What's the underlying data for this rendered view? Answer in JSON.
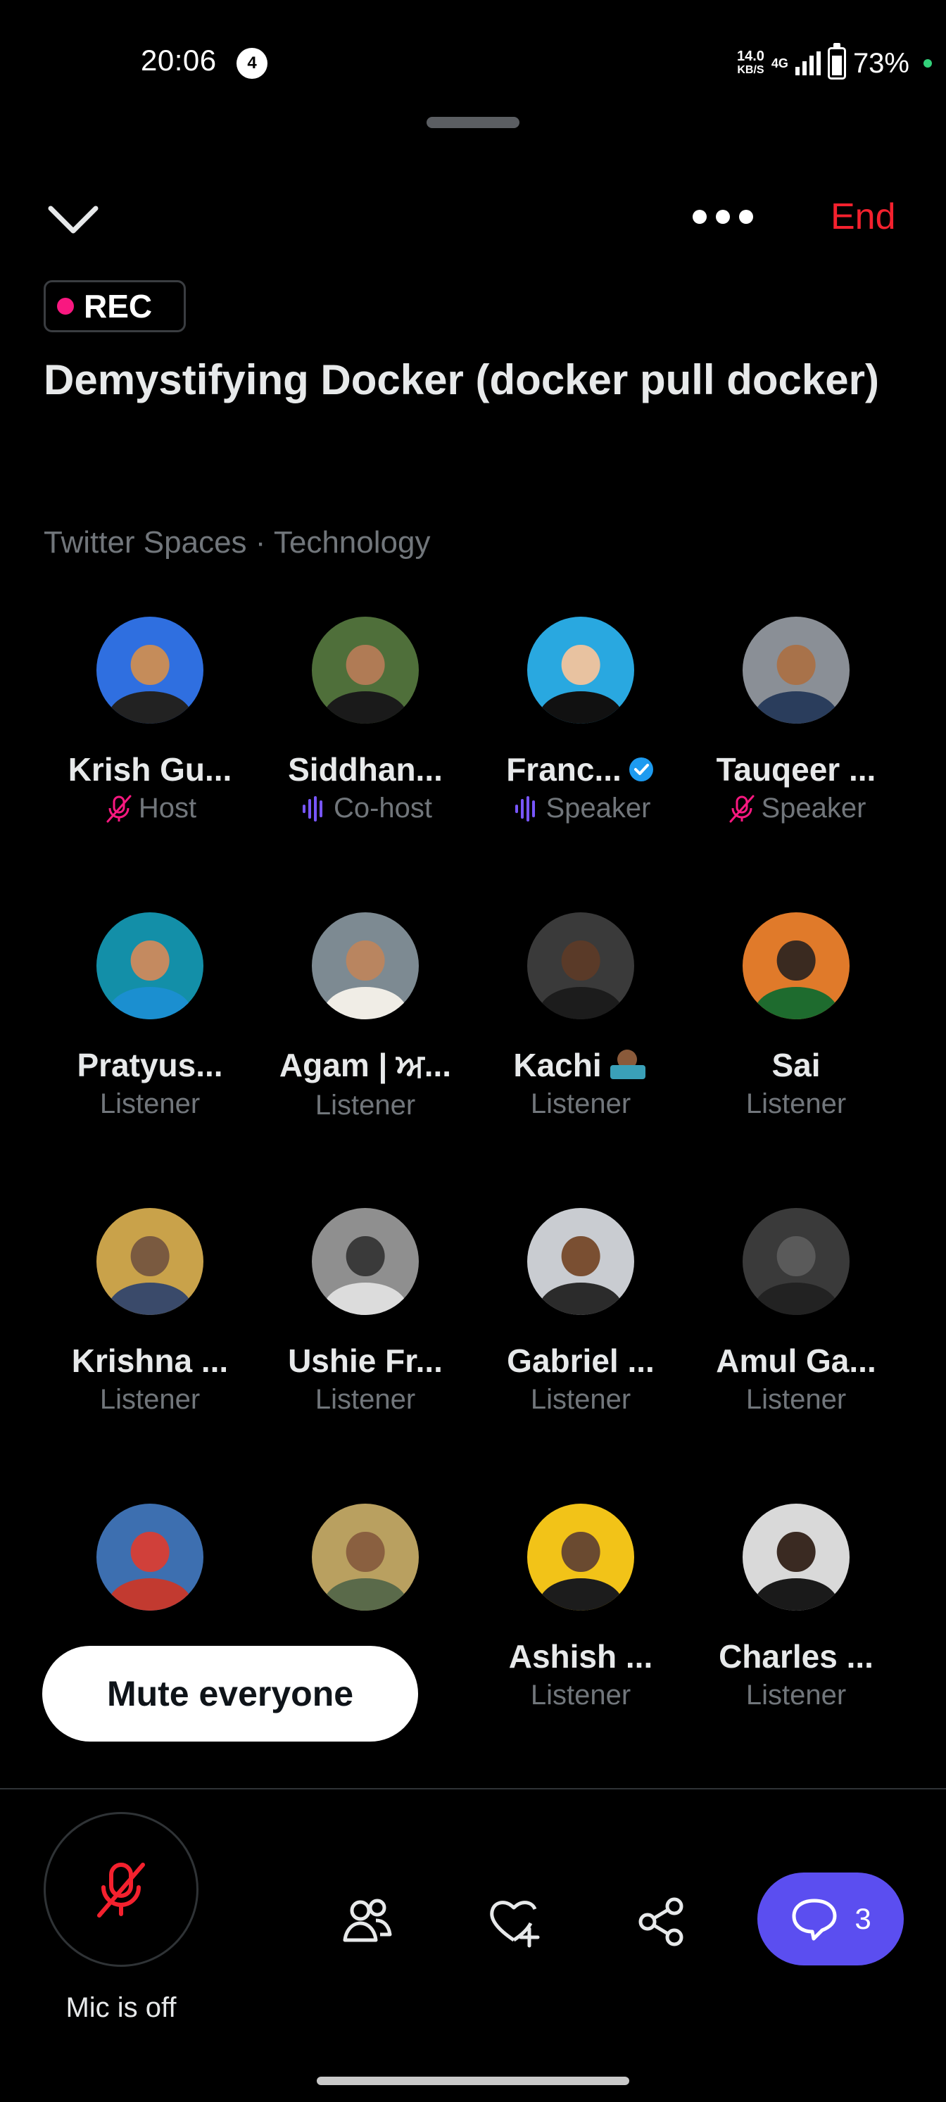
{
  "status_bar": {
    "time": "20:06",
    "notification_count": "4",
    "net_speed_value": "14.0",
    "net_speed_unit": "KB/S",
    "network_type": "4G",
    "battery": "73%"
  },
  "header": {
    "more_label": "More options",
    "end_label": "End"
  },
  "space": {
    "rec_label": "REC",
    "title": "Demystifying Docker (docker pull docker)",
    "subtitle": "Twitter Spaces · Technology"
  },
  "colors": {
    "accent_red": "#f4212e",
    "rec_pink": "#f91880",
    "speaking_purple": "#7856ff",
    "comments_button": "#5b4ef0",
    "muted_gray": "#71767b"
  },
  "participants": [
    {
      "name": "Krish Gu...",
      "role": "Host",
      "role_icon": "mic-off-icon",
      "verified": false,
      "avatar_bg": "#2f6fe0",
      "skin": "#c58c5a",
      "shirt": "#222"
    },
    {
      "name": "Siddhan...",
      "role": "Co-host",
      "role_icon": "speaking-wave-icon",
      "verified": false,
      "avatar_bg": "#4f6f3a",
      "skin": "#b07b55",
      "shirt": "#1a1a1a"
    },
    {
      "name": "Franc...",
      "role": "Speaker",
      "role_icon": "speaking-wave-icon",
      "verified": true,
      "avatar_bg": "#29a8e0",
      "skin": "#e8c2a0",
      "shirt": "#111"
    },
    {
      "name": "Tauqeer ...",
      "role": "Speaker",
      "role_icon": "mic-off-icon",
      "verified": false,
      "avatar_bg": "#8a8f96",
      "skin": "#a8724a",
      "shirt": "#2a3d5c"
    },
    {
      "name": "Pratyus...",
      "role": "Listener",
      "verified": false,
      "avatar_bg": "#138fa8",
      "skin": "#c48a60",
      "shirt": "#1b8fd0"
    },
    {
      "name": "Agam | ਅ...",
      "role": "Listener",
      "verified": false,
      "avatar_bg": "#7d8a92",
      "skin": "#b98560",
      "shirt": "#f0ede6"
    },
    {
      "name": "Kachi",
      "role": "Listener",
      "verified": false,
      "has_emoji": true,
      "emoji_icon": "technologist-emoji-icon",
      "avatar_bg": "#3a3a3a",
      "skin": "#5a3a28",
      "shirt": "#1c1c1c"
    },
    {
      "name": "Sai",
      "role": "Listener",
      "verified": false,
      "avatar_bg": "#e07a2a",
      "skin": "#3a2a20",
      "shirt": "#1e6b2e"
    },
    {
      "name": "Krishna ...",
      "role": "Listener",
      "verified": false,
      "avatar_bg": "#c9a24a",
      "skin": "#7a5a40",
      "shirt": "#3a4a6a"
    },
    {
      "name": "Ushie Fr...",
      "role": "Listener",
      "verified": false,
      "avatar_bg": "#8f8f8f",
      "skin": "#3a3a3a",
      "shirt": "#dcdcdc"
    },
    {
      "name": "Gabriel ...",
      "role": "Listener",
      "verified": false,
      "avatar_bg": "#c9ccd1",
      "skin": "#7a4f32",
      "shirt": "#2b2b2b"
    },
    {
      "name": "Amul Ga...",
      "role": "Listener",
      "verified": false,
      "avatar_bg": "#3a3a3a",
      "skin": "#5a5a5a",
      "shirt": "#222"
    },
    {
      "name": "",
      "role": "",
      "verified": false,
      "avatar_bg": "#3d6fb0",
      "skin": "#d0403a",
      "shirt": "#c23a30"
    },
    {
      "name": "",
      "role": "",
      "verified": false,
      "avatar_bg": "#b9a060",
      "skin": "#8a6040",
      "shirt": "#5a6a4a"
    },
    {
      "name": "Ashish ...",
      "role": "Listener",
      "verified": false,
      "avatar_bg": "#f2c318",
      "skin": "#6a4a30",
      "shirt": "#1c1c1c"
    },
    {
      "name": "Charles ...",
      "role": "Listener",
      "verified": false,
      "avatar_bg": "#d9d9d9",
      "skin": "#3a2a22",
      "shirt": "#1a1a1a"
    }
  ],
  "mute_everyone_label": "Mute everyone",
  "mic": {
    "label": "Mic is off",
    "icon": "mic-off-icon"
  },
  "toolbar": {
    "participants_icon": "people-icon",
    "react_icon": "heart-plus-icon",
    "share_icon": "share-icon",
    "comments_icon": "chat-bubble-icon",
    "comments_count": "3"
  }
}
